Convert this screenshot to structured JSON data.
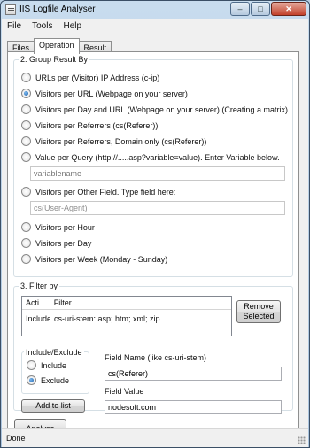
{
  "window": {
    "title": "IIS Logfile Analyser",
    "minimize": "–",
    "maximize": "□",
    "close": "✕"
  },
  "menu": [
    "File",
    "Tools",
    "Help"
  ],
  "tabs": [
    "Files",
    "Operation",
    "Result"
  ],
  "group_by": {
    "title": "2. Group Result By",
    "options": [
      "URLs per (Visitor) IP Address (c-ip)",
      "Visitors per URL (Webpage on your server)",
      "Visitors per Day and URL (Webpage on your server) (Creating a matrix)",
      "Visitors per Referrers (cs(Referer))",
      "Visitors per Referrers, Domain only (cs(Referer))",
      "Value per Query (http://.....asp?variable=value). Enter Variable below.",
      "Visitors per Other Field. Type field here:",
      "Visitors per Hour",
      "Visitors per Day",
      "Visitors per Week (Monday - Sunday)"
    ],
    "selected_index": 1,
    "variable_placeholder": "variablename",
    "other_field_value": "cs(User-Agent)"
  },
  "filter": {
    "title": "3. Filter by",
    "columns": [
      "Acti...",
      "Filter"
    ],
    "rows": [
      {
        "action": "Include",
        "filter": "cs-uri-stem:.asp;.htm;.xml;.zip"
      }
    ],
    "remove_button": "Remove Selected",
    "include_exclude_title": "Include/Exclude",
    "include_label": "Include",
    "exclude_label": "Exclude",
    "selected_mode": "Exclude",
    "field_name_label": "Field Name (like cs-uri-stem)",
    "field_name_value": "cs(Referer)",
    "field_value_label": "Field Value",
    "field_value_value": "nodesoft.com",
    "add_button": "Add to list"
  },
  "analyse_button": "Analyse",
  "status": "Done"
}
